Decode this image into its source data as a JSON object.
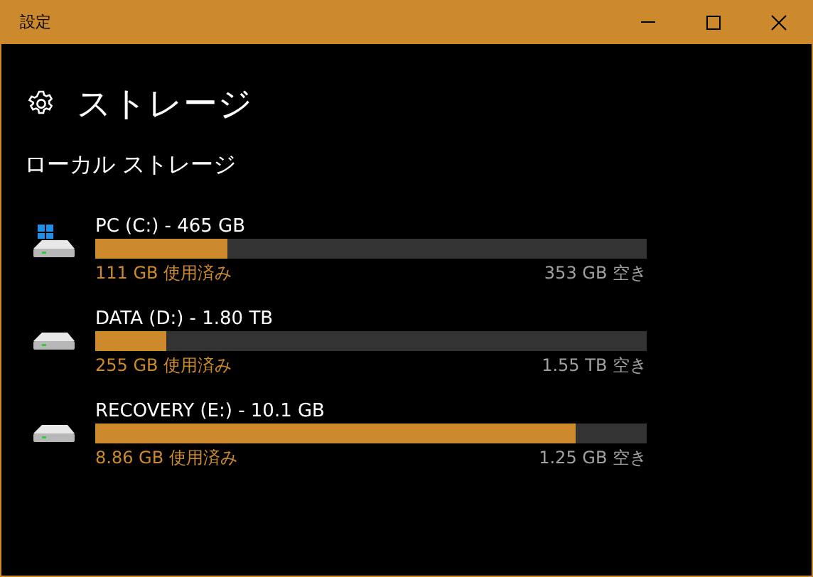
{
  "window": {
    "title": "設定"
  },
  "page": {
    "title": "ストレージ"
  },
  "section": {
    "title": "ローカル ストレージ"
  },
  "drives": [
    {
      "name": "PC (C:) - 465 GB",
      "system_drive": true,
      "level": 0.24,
      "used": "111 GB 使用済み",
      "free": "353 GB 空き"
    },
    {
      "name": "DATA (D:) - 1.80 TB",
      "system_drive": false,
      "level": 0.13,
      "used": "255 GB 使用済み",
      "free": "1.55 TB 空き"
    },
    {
      "name": "RECOVERY (E:) - 10.1 GB",
      "system_drive": false,
      "level": 0.87,
      "used": "8.86 GB 使用済み",
      "free": "1.25 GB 空き"
    }
  ]
}
